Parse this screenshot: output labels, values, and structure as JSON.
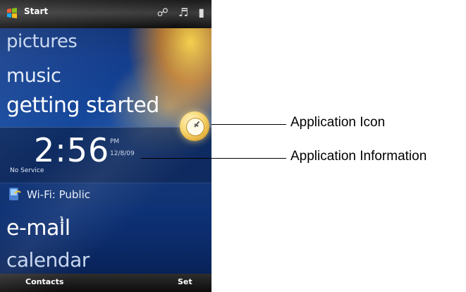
{
  "topbar": {
    "start_label": "Start"
  },
  "menu": {
    "pictures": "pictures",
    "music": "music",
    "getting_started": "getting started",
    "email": "e-mail",
    "email_count": "1",
    "calendar": "calendar"
  },
  "clock": {
    "time": "2:56",
    "ampm": "PM",
    "date": "12/8/09",
    "carrier": "No Service"
  },
  "wifi": {
    "label": "Wi-Fi: Public"
  },
  "softkeys": {
    "left": "Contacts",
    "right": "Set"
  },
  "callouts": {
    "app_icon": "Application Icon",
    "app_info": "Application Information"
  }
}
